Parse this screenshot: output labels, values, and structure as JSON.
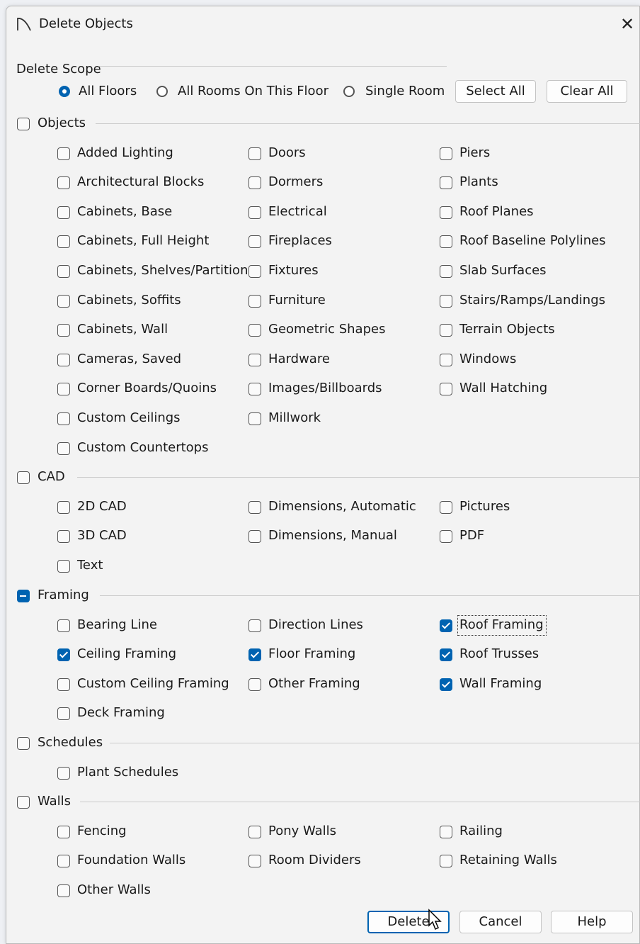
{
  "window": {
    "title": "Delete Objects",
    "close_glyph": "✕"
  },
  "scope": {
    "heading": "Delete Scope",
    "options": [
      {
        "label": "All Floors",
        "selected": true
      },
      {
        "label": "All Rooms On This Floor",
        "selected": false
      },
      {
        "label": "Single Room",
        "selected": false
      }
    ],
    "select_all_label": "Select All",
    "clear_all_label": "Clear All"
  },
  "sections": [
    {
      "label": "Objects",
      "state": "unchecked",
      "items": [
        [
          "Added Lighting",
          false
        ],
        [
          "Doors",
          false
        ],
        [
          "Piers",
          false
        ],
        [
          "Architectural Blocks",
          false
        ],
        [
          "Dormers",
          false
        ],
        [
          "Plants",
          false
        ],
        [
          "Cabinets, Base",
          false
        ],
        [
          "Electrical",
          false
        ],
        [
          "Roof Planes",
          false
        ],
        [
          "Cabinets, Full Height",
          false
        ],
        [
          "Fireplaces",
          false
        ],
        [
          "Roof Baseline Polylines",
          false
        ],
        [
          "Cabinets, Shelves/Partitions",
          false
        ],
        [
          "Fixtures",
          false
        ],
        [
          "Slab Surfaces",
          false
        ],
        [
          "Cabinets, Soffits",
          false
        ],
        [
          "Furniture",
          false
        ],
        [
          "Stairs/Ramps/Landings",
          false
        ],
        [
          "Cabinets, Wall",
          false
        ],
        [
          "Geometric Shapes",
          false
        ],
        [
          "Terrain Objects",
          false
        ],
        [
          "Cameras, Saved",
          false
        ],
        [
          "Hardware",
          false
        ],
        [
          "Windows",
          false
        ],
        [
          "Corner Boards/Quoins",
          false
        ],
        [
          "Images/Billboards",
          false
        ],
        [
          "Wall Hatching",
          false
        ],
        [
          "Custom Ceilings",
          false
        ],
        [
          "Millwork",
          false
        ],
        null,
        [
          "Custom Countertops",
          false
        ],
        null,
        null
      ]
    },
    {
      "label": "CAD",
      "state": "unchecked",
      "items": [
        [
          "2D CAD",
          false
        ],
        [
          "Dimensions, Automatic",
          false
        ],
        [
          "Pictures",
          false
        ],
        [
          "3D CAD",
          false
        ],
        [
          "Dimensions, Manual",
          false
        ],
        [
          "PDF",
          false
        ],
        [
          "Text",
          false
        ],
        null,
        null
      ]
    },
    {
      "label": "Framing",
      "state": "mixed",
      "items": [
        [
          "Bearing Line",
          false
        ],
        [
          "Direction Lines",
          false
        ],
        [
          "Roof Framing",
          true
        ],
        [
          "Ceiling Framing",
          true
        ],
        [
          "Floor Framing",
          true
        ],
        [
          "Roof Trusses",
          true
        ],
        [
          "Custom Ceiling Framing",
          false
        ],
        [
          "Other Framing",
          false
        ],
        [
          "Wall Framing",
          true
        ],
        [
          "Deck Framing",
          false
        ],
        null,
        null
      ]
    },
    {
      "label": "Schedules",
      "state": "unchecked",
      "items": [
        [
          "Plant Schedules",
          false
        ],
        null,
        null
      ]
    },
    {
      "label": "Walls",
      "state": "unchecked",
      "items": [
        [
          "Fencing",
          false
        ],
        [
          "Pony Walls",
          false
        ],
        [
          "Railing",
          false
        ],
        [
          "Foundation Walls",
          false
        ],
        [
          "Room Dividers",
          false
        ],
        [
          "Retaining Walls",
          false
        ],
        [
          "Other Walls",
          false
        ],
        null,
        null
      ]
    }
  ],
  "focused_item": "Roof Framing",
  "footer": {
    "delete_label": "Delete",
    "cancel_label": "Cancel",
    "help_label": "Help"
  },
  "colors": {
    "accent": "#0063b1",
    "dialog_bg": "#f3f3f3"
  }
}
